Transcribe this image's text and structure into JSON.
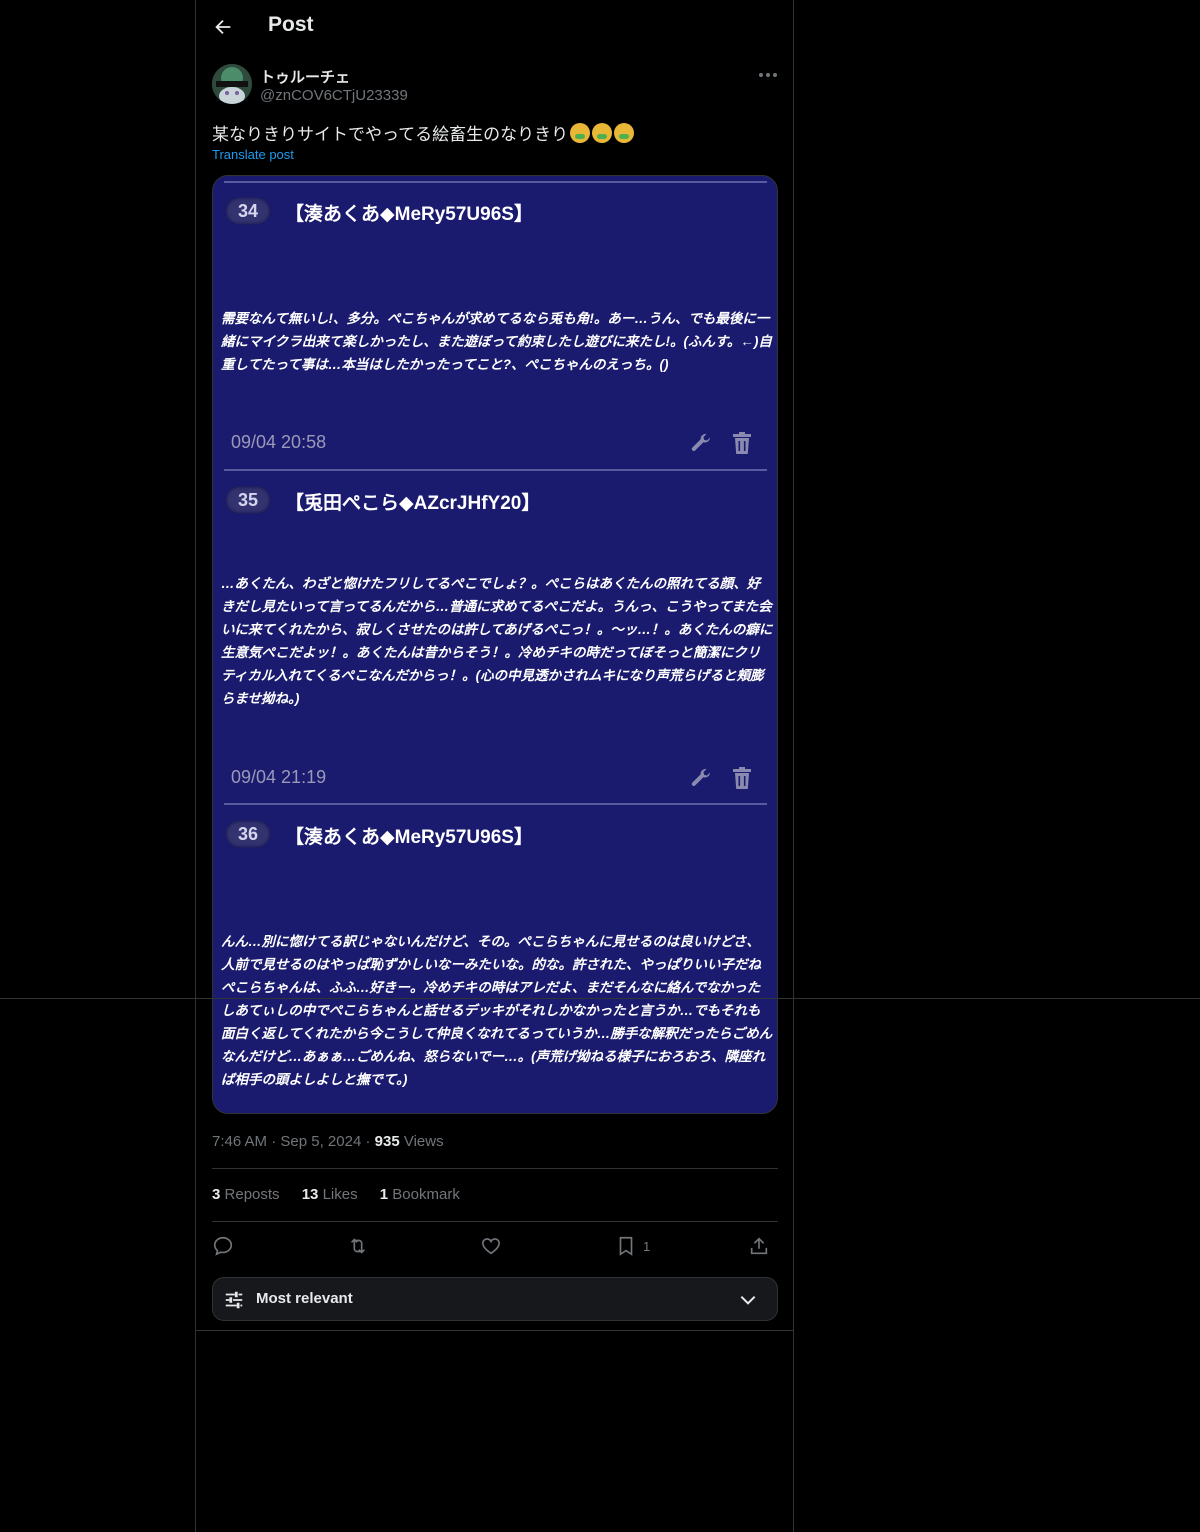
{
  "header": {
    "title": "Post"
  },
  "post": {
    "author_name": "トゥルーチェ",
    "handle": "@znCOV6CTjU23339",
    "text": "某なりきりサイトでやってる絵畜生のなりきり",
    "translate_label": "Translate post",
    "time": "7:46 AM",
    "date": "Sep 5, 2024",
    "views_count": "935",
    "views_label": "Views"
  },
  "image": {
    "entries": [
      {
        "number": "34",
        "author": "【湊あくあ◆MeRy57U96S】",
        "body": "需要なんて無いし!、多分。ぺこちゃんが求めてるなら兎も角!。あー…うん、でも最後に一緒にマイクラ出来て楽しかったし、また遊ぼって約束したし遊びに来たし!。(ふんす。←)自重してたって事は…本当はしたかったってこと?、ぺこちゃんのえっち。()",
        "date": "09/04 20:58"
      },
      {
        "number": "35",
        "author": "【兎田ぺこら◆AZcrJHfY20】",
        "body": "…あくたん、わざと惚けたフリしてるぺこでしょ？。ぺこらはあくたんの照れてる顔、好きだし見たいって言ってるんだから…普通に求めてるぺこだよ。うんっ、こうやってまた会いに来てくれたから、寂しくさせたのは許してあげるぺこっ！。〜ッ…！。あくたんの癖に生意気ぺこだよッ！。あくたんは昔からそう！。冷めチキの時だってぼそっと簡潔にクリティカル入れてくるぺこなんだからっ！。(心の中見透かされムキになり声荒らげると頬膨らませ拗ね。)",
        "date": "09/04 21:19"
      },
      {
        "number": "36",
        "author": "【湊あくあ◆MeRy57U96S】",
        "body": "んん…別に惚けてる訳じゃないんだけど、その。ぺこらちゃんに見せるのは良いけどさ、人前で見せるのはやっぱ恥ずかしいなーみたいな。的な。許された、やっぱりいい子だねぺこらちゃんは、ふふ…好きー。冷めチキの時はアレだよ、まだそんなに絡んでなかったしあてぃしの中でぺこらちゃんと話せるデッキがそれしかなかったと言うか…でもそれも面白く返してくれたから今こうして仲良くなれてるっていうか…勝手な解釈だったらごめんなんだけど…あぁぁ…ごめんね、怒らないでー…。(声荒げ拗ねる様子におろおろ、隣座れば相手の頭よしよしと撫でて。)",
        "date": ""
      }
    ]
  },
  "stats": {
    "reposts_count": "3",
    "reposts_label": "Reposts",
    "likes_count": "13",
    "likes_label": "Likes",
    "bookmarks_count": "1",
    "bookmarks_label": "Bookmark"
  },
  "actions": {
    "bookmark_count": "1"
  },
  "sort": {
    "label": "Most relevant"
  },
  "icons": [
    "back-arrow-icon",
    "more-icon",
    "wrench-icon",
    "trash-icon",
    "reply-icon",
    "repost-icon",
    "like-icon",
    "bookmark-icon",
    "share-icon",
    "sliders-icon",
    "chevron-down-icon"
  ]
}
